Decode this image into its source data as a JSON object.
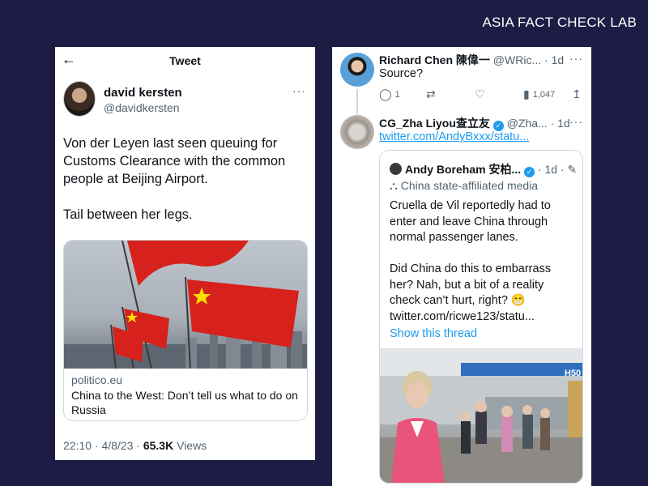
{
  "brand": "ASIA FACT CHECK LAB",
  "left_tweet": {
    "header_title": "Tweet",
    "back_icon": "arrow-left-icon",
    "author_name": "david kersten",
    "author_handle": "@davidkersten",
    "more": "···",
    "text_1": "Von der Leyen last seen queuing for Customs Clearance with the common people at Beijing Airport.",
    "text_2": "Tail between her legs.",
    "card_domain": "politico.eu",
    "card_headline": "China to the West: Don’t tell us what to do on Russia",
    "meta_time": "22:10 · 4/8/23 · ",
    "meta_views_count": "65.3K",
    "meta_views_label": " Views"
  },
  "right_thread": {
    "reply1": {
      "name": "Richard Chen 陳偉一",
      "handle": "@WRic...",
      "time": "· 1d",
      "more": "···",
      "text": "Source?",
      "reply_count": "1",
      "views": "1,047"
    },
    "reply2": {
      "name": "CG_Zha Liyou查立友",
      "handle": "@Zha...",
      "time": "· 1d",
      "more": "···",
      "link": "twitter.com/AndyBxxx/statu..."
    },
    "quote": {
      "name": "Andy Boreham 安柏...",
      "time": "· 1d ·",
      "state_label": "China state-affiliated media",
      "text_1": "Cruella de Vil reportedly had to enter and leave China through normal passenger lanes.",
      "text_2": "Did China do this to embarrass her? Nah, but a bit of a reality check can’t hurt, right? 😁 twitter.com/ricwe123/statu...",
      "show_thread": "Show this thread",
      "airport_sign": "H50"
    }
  }
}
